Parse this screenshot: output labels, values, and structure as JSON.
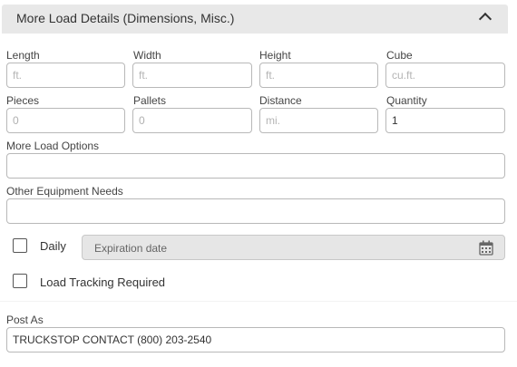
{
  "panel": {
    "title": "More Load Details (Dimensions, Misc.)"
  },
  "fields": {
    "length": {
      "label": "Length",
      "placeholder": "ft.",
      "value": ""
    },
    "width": {
      "label": "Width",
      "placeholder": "ft.",
      "value": ""
    },
    "height": {
      "label": "Height",
      "placeholder": "ft.",
      "value": ""
    },
    "cube": {
      "label": "Cube",
      "placeholder": "cu.ft.",
      "value": ""
    },
    "pieces": {
      "label": "Pieces",
      "placeholder": "",
      "value": "0"
    },
    "pallets": {
      "label": "Pallets",
      "placeholder": "",
      "value": "0"
    },
    "distance": {
      "label": "Distance",
      "placeholder": "mi.",
      "value": ""
    },
    "quantity": {
      "label": "Quantity",
      "placeholder": "",
      "value": "1"
    },
    "more_load_options": {
      "label": "More Load Options",
      "value": ""
    },
    "other_equipment": {
      "label": "Other Equipment Needs",
      "value": ""
    },
    "post_as": {
      "label": "Post As",
      "value": "TRUCKSTOP CONTACT (800) 203-2540"
    }
  },
  "daily": {
    "label": "Daily",
    "checked": false
  },
  "expiration": {
    "placeholder": "Expiration date",
    "icon": "calendar-icon"
  },
  "load_tracking": {
    "label": "Load Tracking Required",
    "checked": false
  },
  "icons": {
    "collapse": "chevron-up-icon"
  }
}
